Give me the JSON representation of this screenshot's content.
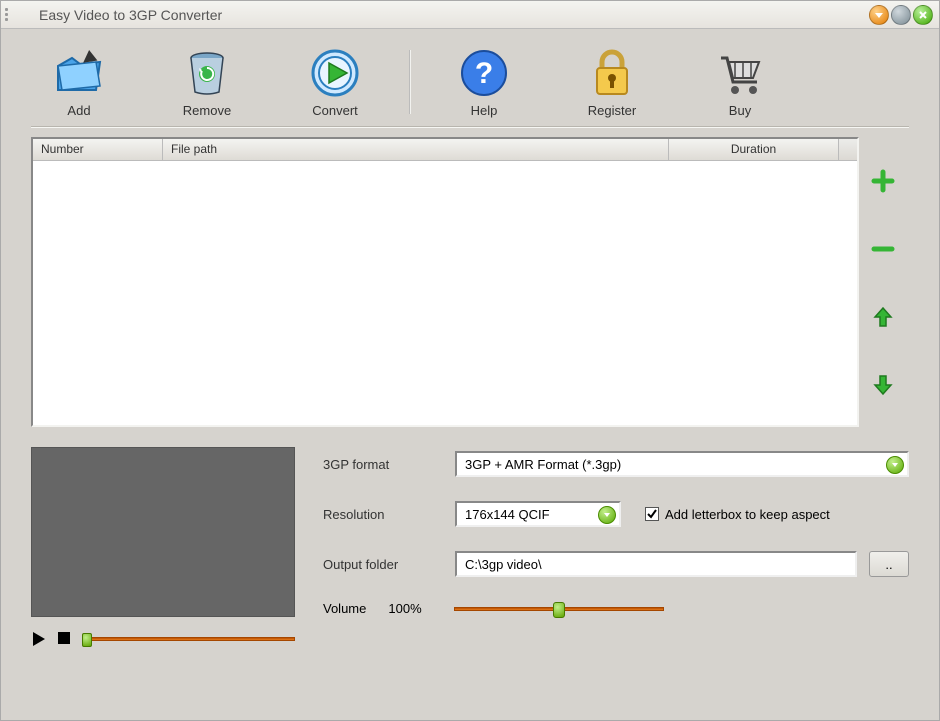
{
  "window": {
    "title": "Easy Video to 3GP Converter"
  },
  "toolbar": {
    "add": "Add",
    "remove": "Remove",
    "convert": "Convert",
    "help": "Help",
    "register": "Register",
    "buy": "Buy"
  },
  "filelist": {
    "columns": {
      "number": "Number",
      "filepath": "File path",
      "duration": "Duration"
    },
    "rows": []
  },
  "settings": {
    "format_label": "3GP format",
    "format_value": "3GP + AMR Format (*.3gp)",
    "resolution_label": "Resolution",
    "resolution_value": "176x144 QCIF",
    "letterbox_label": "Add letterbox to keep aspect",
    "letterbox_checked": true,
    "output_label": "Output folder",
    "output_value": "C:\\3gp video\\",
    "browse_label": "..",
    "volume_label": "Volume",
    "volume_value": "100%"
  }
}
